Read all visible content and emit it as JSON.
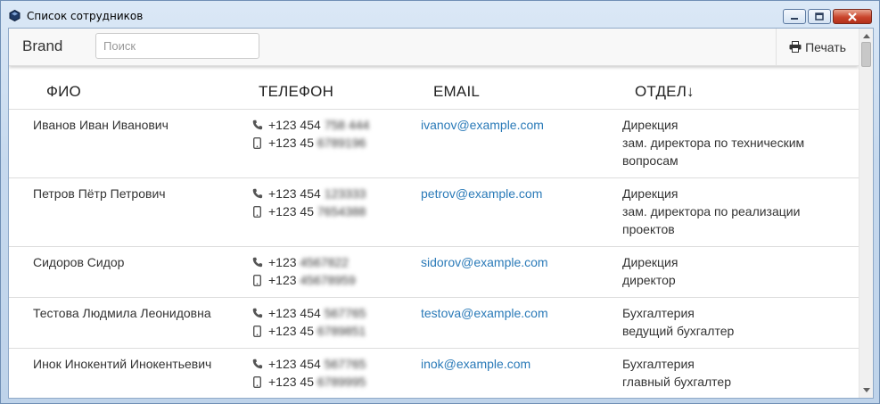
{
  "window": {
    "title": "Список сотрудников"
  },
  "navbar": {
    "brand": "Brand",
    "search_placeholder": "Поиск",
    "print_label": "Печать"
  },
  "table": {
    "headers": {
      "name": "ФИО",
      "phone": "ТЕЛЕФОН",
      "email": "EMAIL",
      "dept": "ОТДЕЛ↓"
    },
    "rows": [
      {
        "name": "Иванов Иван Иванович",
        "phone1": "+123 454",
        "phone1_hidden": "758 444",
        "phone2": "+123 45",
        "phone2_hidden": "6789196",
        "email": "ivanov@example.com",
        "department": "Дирекция",
        "position": "зам. директора по техническим вопросам"
      },
      {
        "name": "Петров Пётр Петрович",
        "phone1": "+123 454",
        "phone1_hidden": "123333",
        "phone2": "+123 45",
        "phone2_hidden": "7654388",
        "email": "petrov@example.com",
        "department": "Дирекция",
        "position": "зам. директора по реализации проектов"
      },
      {
        "name": "Сидоров Сидор",
        "phone1": "+123",
        "phone1_hidden": "4567822",
        "phone2": "+123",
        "phone2_hidden": "45678959",
        "email": "sidorov@example.com",
        "department": "Дирекция",
        "position": "директор"
      },
      {
        "name": "Тестова Людмила Леонидовна",
        "phone1": "+123 454",
        "phone1_hidden": "567765",
        "phone2": "+123 45",
        "phone2_hidden": "6789851",
        "email": "testova@example.com",
        "department": "Бухгалтерия",
        "position": "ведущий бухгалтер"
      },
      {
        "name": "Инок Инокентий Инокентьевич",
        "phone1": "+123 454",
        "phone1_hidden": "567765",
        "phone2": "+123 45",
        "phone2_hidden": "6789995",
        "email": "inok@example.com",
        "department": "Бухгалтерия",
        "position": "главный бухгалтер"
      }
    ]
  }
}
